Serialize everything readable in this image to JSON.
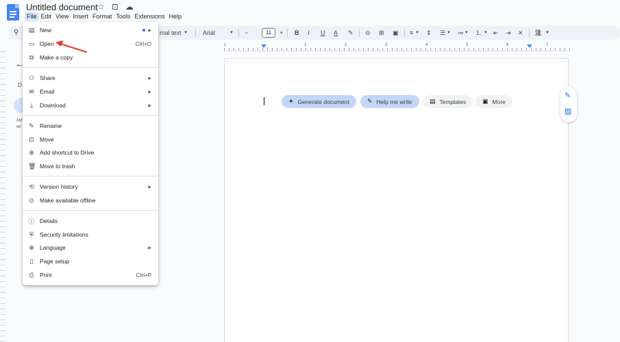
{
  "title": "Untitled document",
  "title_icons": [
    "☆",
    "⊡",
    "☁"
  ],
  "menubar": [
    "File",
    "Edit",
    "View",
    "Insert",
    "Format",
    "Tools",
    "Extensions",
    "Help"
  ],
  "toolbar": {
    "style_value": "mal text",
    "font_value": "Arial",
    "font_size": "11",
    "minus": "−",
    "plus": "+",
    "bold": "B",
    "italic": "I",
    "underline": "U",
    "text_color": "A",
    "highlight": "✎",
    "insert_link": "⊝",
    "add_comment": "⊞",
    "insert_image": "▣",
    "align": "≡",
    "line_spacing": "⇕",
    "checklist": "☰",
    "bullets": "≔",
    "numbers": "⒈",
    "decrease_indent": "⇤",
    "increase_indent": "⇥",
    "clear_format": "✕",
    "annotate": "注"
  },
  "ruler": {
    "numbers": [
      "1",
      "1",
      "2",
      "3",
      "4",
      "5",
      "6",
      "7"
    ]
  },
  "left_panel": {
    "back": "←",
    "letter": "D",
    "help": "He\nwi"
  },
  "chips": {
    "generate": "Generate document",
    "help_write": "Help me write",
    "templates": "Templates",
    "more": "More"
  },
  "file_menu": [
    {
      "label": "New",
      "icon": "▤",
      "submenu": true,
      "dot": true
    },
    {
      "label": "Open",
      "icon": "▭",
      "shortcut": "Ctrl+O"
    },
    {
      "label": "Make a copy",
      "icon": "⧉"
    },
    {
      "label": "Share",
      "icon": "⚇",
      "submenu": true
    },
    {
      "label": "Email",
      "icon": "✉",
      "submenu": true
    },
    {
      "label": "Download",
      "icon": "⤓",
      "submenu": true
    },
    {
      "label": "Rename",
      "icon": "✎"
    },
    {
      "label": "Move",
      "icon": "⊡"
    },
    {
      "label": "Add shortcut to Drive",
      "icon": "⊕"
    },
    {
      "label": "Move to trash",
      "icon": "🗑"
    },
    {
      "label": "Version history",
      "icon": "⟲",
      "submenu": true
    },
    {
      "label": "Make available offline",
      "icon": "⊙"
    },
    {
      "label": "Details",
      "icon": "ⓘ"
    },
    {
      "label": "Security limitations",
      "icon": "⛨"
    },
    {
      "label": "Language",
      "icon": "⊕",
      "submenu": true
    },
    {
      "label": "Page setup",
      "icon": "▯"
    },
    {
      "label": "Print",
      "icon": "⎙",
      "shortcut": "Ctrl+P"
    }
  ],
  "colors": {
    "accent": "#1a73e8",
    "menu_active": "#d3e3fd",
    "chip_blue": "#c2d7f7",
    "annotation_arrow": "#e53935"
  }
}
